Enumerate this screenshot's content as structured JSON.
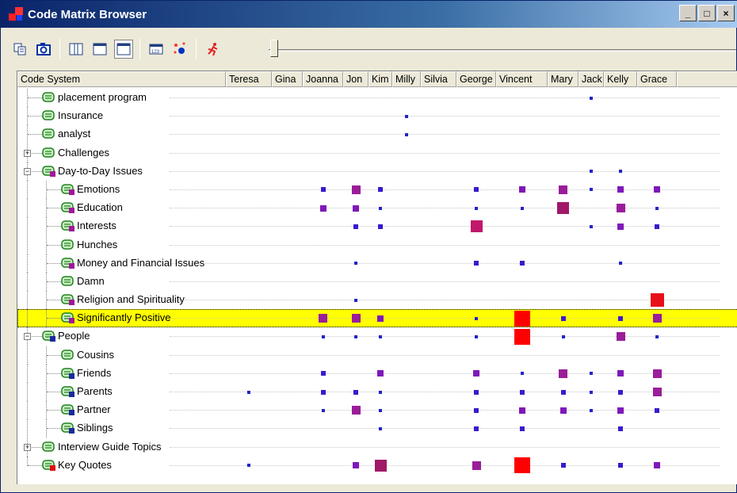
{
  "window": {
    "title": "Code Matrix Browser",
    "min_label": "_",
    "max_label": "□",
    "close_label": "×"
  },
  "toolbar": {
    "items": [
      "copy-icon",
      "camera-icon",
      "columns-icon",
      "rows-icon",
      "square-icon",
      "grid-123-icon",
      "nodes-icon",
      "runner-icon"
    ]
  },
  "header": {
    "code_system": "Code System",
    "columns": [
      "Teresa",
      "Gina",
      "Joanna",
      "Jon",
      "Kim",
      "Milly",
      "Silvia",
      "George",
      "Vincent",
      "Mary",
      "Jack",
      "Kelly",
      "Grace"
    ]
  },
  "rows": [
    {
      "label": "placement program",
      "level": 1,
      "expander": "",
      "icon": "plain"
    },
    {
      "label": "Insurance",
      "level": 1,
      "expander": "",
      "icon": "plain"
    },
    {
      "label": "analyst",
      "level": 1,
      "expander": "",
      "icon": "plain"
    },
    {
      "label": "Challenges",
      "level": 1,
      "expander": "+",
      "icon": "plain"
    },
    {
      "label": "Day-to-Day Issues",
      "level": 1,
      "expander": "−",
      "icon": "purple"
    },
    {
      "label": "Emotions",
      "level": 2,
      "expander": "",
      "icon": "purple"
    },
    {
      "label": "Education",
      "level": 2,
      "expander": "",
      "icon": "purple"
    },
    {
      "label": "Interests",
      "level": 2,
      "expander": "",
      "icon": "purple"
    },
    {
      "label": "Hunches",
      "level": 2,
      "expander": "",
      "icon": "plain"
    },
    {
      "label": "Money and Financial Issues",
      "level": 2,
      "expander": "",
      "icon": "purple"
    },
    {
      "label": "Damn",
      "level": 2,
      "expander": "",
      "icon": "plain"
    },
    {
      "label": "Religion and Spirituality",
      "level": 2,
      "expander": "",
      "icon": "purple"
    },
    {
      "label": "Significantly Positive",
      "level": 2,
      "expander": "",
      "icon": "purple",
      "selected": true
    },
    {
      "label": "People",
      "level": 1,
      "expander": "−",
      "icon": "blue"
    },
    {
      "label": "Cousins",
      "level": 2,
      "expander": "",
      "icon": "plain"
    },
    {
      "label": "Friends",
      "level": 2,
      "expander": "",
      "icon": "blue"
    },
    {
      "label": "Parents",
      "level": 2,
      "expander": "",
      "icon": "blue"
    },
    {
      "label": "Partner",
      "level": 2,
      "expander": "",
      "icon": "blue"
    },
    {
      "label": "Siblings",
      "level": 2,
      "expander": "",
      "icon": "blue"
    },
    {
      "label": "Interview Guide Topics",
      "level": 1,
      "expander": "+",
      "icon": "plain"
    },
    {
      "label": "Key Quotes",
      "level": 1,
      "expander": "",
      "icon": "red"
    }
  ],
  "matrix": [
    [
      0,
      0,
      0,
      0,
      0,
      0,
      0,
      0,
      0,
      0,
      1,
      0,
      0
    ],
    [
      0,
      0,
      0,
      0,
      0,
      1,
      0,
      0,
      0,
      0,
      0,
      0,
      0
    ],
    [
      0,
      0,
      0,
      0,
      0,
      1,
      0,
      0,
      0,
      0,
      0,
      0,
      0
    ],
    [
      0,
      0,
      0,
      0,
      0,
      0,
      0,
      0,
      0,
      0,
      0,
      0,
      0
    ],
    [
      0,
      0,
      0,
      0,
      0,
      0,
      0,
      0,
      0,
      0,
      1,
      1,
      0
    ],
    [
      0,
      0,
      2,
      4,
      2,
      0,
      0,
      2,
      3,
      4,
      1,
      3,
      3
    ],
    [
      0,
      0,
      3,
      3,
      1,
      0,
      0,
      1,
      1,
      5,
      0,
      4,
      1
    ],
    [
      0,
      0,
      0,
      2,
      2,
      0,
      0,
      6,
      0,
      0,
      1,
      3,
      2
    ],
    [
      0,
      0,
      0,
      0,
      0,
      0,
      0,
      0,
      0,
      0,
      0,
      0,
      0
    ],
    [
      0,
      0,
      0,
      1,
      0,
      0,
      0,
      2,
      2,
      0,
      0,
      1,
      0
    ],
    [
      0,
      0,
      0,
      0,
      0,
      0,
      0,
      0,
      0,
      0,
      0,
      0,
      0
    ],
    [
      0,
      0,
      0,
      1,
      0,
      0,
      0,
      0,
      0,
      0,
      0,
      0,
      7
    ],
    [
      0,
      0,
      4,
      4,
      3,
      0,
      0,
      1,
      8,
      2,
      0,
      2,
      4
    ],
    [
      0,
      0,
      1,
      1,
      1,
      0,
      0,
      1,
      8,
      1,
      0,
      4,
      1
    ],
    [
      0,
      0,
      0,
      0,
      0,
      0,
      0,
      0,
      0,
      0,
      0,
      0,
      0
    ],
    [
      0,
      0,
      2,
      0,
      3,
      0,
      0,
      3,
      1,
      4,
      1,
      3,
      4
    ],
    [
      1,
      0,
      2,
      2,
      1,
      0,
      0,
      2,
      2,
      2,
      1,
      2,
      4
    ],
    [
      0,
      0,
      1,
      4,
      1,
      0,
      0,
      2,
      3,
      3,
      1,
      3,
      2
    ],
    [
      0,
      0,
      0,
      0,
      1,
      0,
      0,
      2,
      2,
      0,
      0,
      2,
      0
    ],
    [
      0,
      0,
      0,
      0,
      0,
      0,
      0,
      0,
      0,
      0,
      0,
      0,
      0
    ],
    [
      1,
      0,
      0,
      3,
      5,
      0,
      0,
      4,
      8,
      2,
      0,
      2,
      3
    ]
  ],
  "colors": {
    "blue": "#2323c8",
    "purple": "#7f18b8",
    "violet": "#9a1d9a",
    "magenta": "#a01868",
    "red": "#ff0000",
    "selected": "#ffff00"
  }
}
